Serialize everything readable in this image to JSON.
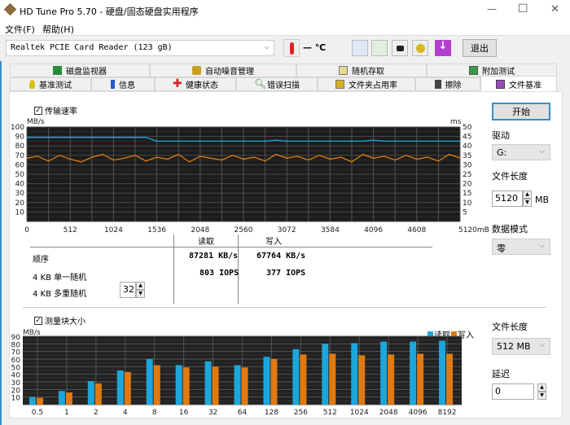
{
  "window": {
    "title": "HD Tune Pro 5.70 - 硬盘/固态硬盘实用程序",
    "minimize": "—",
    "maximize": "☐",
    "close": "✕"
  },
  "menu": [
    "文件(F)",
    "帮助(H)"
  ],
  "toolbar": {
    "drive": "Realtek PCIE Card Reader (123 gB)",
    "temp": "— ℃",
    "exit": "退出"
  },
  "tabs_row1": [
    "磁盘监视器",
    "自动噪音管理",
    "随机存取",
    "附加测试"
  ],
  "tabs_row2": [
    "基准测试",
    "信息",
    "健康状态",
    "错误扫描",
    "文件夹占用率",
    "擦除",
    "文件基准"
  ],
  "transfer": {
    "checkbox": "传输速率",
    "unit_left": "MB/s",
    "unit_right": "ms"
  },
  "results": {
    "col_read": "读取",
    "col_write": "写入",
    "rows": [
      {
        "label": "顺序",
        "read": "87281 KB/s",
        "write": "67764 KB/s"
      },
      {
        "label": "4 KB 单一随机",
        "read": "803 IOPS",
        "write": "377 IOPS"
      },
      {
        "label": "4 KB 多重随机",
        "read": "",
        "write": ""
      }
    ],
    "queue_depth": "32"
  },
  "right_top": {
    "start": "开始",
    "drive_label": "驱动",
    "drive": "G:",
    "file_len_label": "文件长度",
    "file_len": "5120",
    "file_len_unit": "MB",
    "pattern_label": "数据模式",
    "pattern": "零"
  },
  "block": {
    "checkbox": "测量块大小"
  },
  "right_bottom": {
    "file_len_label": "文件长度",
    "file_len": "512 MB",
    "delay_label": "延迟",
    "delay": "0"
  },
  "colors": {
    "read": "#1ca7dc",
    "write": "#e07a10",
    "accent": "#3a8fc7"
  },
  "chart_data": [
    {
      "type": "line",
      "title": "传输速率",
      "xlabel": "mB",
      "ylabel": "MB/s",
      "y2label": "ms",
      "xlim": [
        0,
        5120
      ],
      "ylim": [
        0,
        100
      ],
      "y2lim": [
        0,
        50
      ],
      "xticks": [
        "0",
        "512",
        "1024",
        "1536",
        "2048",
        "2560",
        "3072",
        "3584",
        "4096",
        "4608",
        "5120mB"
      ],
      "yticks": [
        "100",
        "90",
        "80",
        "70",
        "60",
        "50",
        "40",
        "30",
        "20",
        "10"
      ],
      "y2ticks": [
        "50",
        "45",
        "40",
        "35",
        "30",
        "25",
        "20",
        "15",
        "10",
        "5"
      ],
      "x": [
        0,
        128,
        256,
        384,
        512,
        640,
        768,
        896,
        1024,
        1152,
        1280,
        1408,
        1536,
        1664,
        1792,
        1920,
        2048,
        2176,
        2304,
        2432,
        2560,
        2688,
        2816,
        2944,
        3072,
        3200,
        3328,
        3456,
        3584,
        3712,
        3840,
        3968,
        4096,
        4224,
        4352,
        4480,
        4608,
        4736,
        4864,
        4992,
        5120
      ],
      "series": [
        {
          "name": "读取",
          "values": [
            89,
            89,
            89,
            89,
            89,
            89,
            89,
            89,
            89,
            89,
            89,
            89,
            85,
            85,
            85,
            85,
            85,
            85,
            85,
            85,
            85,
            85,
            85,
            86,
            85,
            85,
            85,
            85,
            85,
            85,
            85,
            85,
            86,
            85,
            85,
            85,
            85,
            85,
            85,
            85,
            85
          ]
        },
        {
          "name": "写入",
          "values": [
            67,
            69,
            64,
            70,
            66,
            63,
            68,
            71,
            65,
            67,
            70,
            64,
            68,
            66,
            71,
            63,
            69,
            67,
            65,
            70,
            66,
            68,
            64,
            71,
            67,
            69,
            65,
            70,
            66,
            68,
            63,
            71,
            67,
            69,
            65,
            70,
            66,
            68,
            64,
            71,
            67
          ]
        }
      ]
    },
    {
      "type": "bar",
      "title": "测量块大小",
      "ylabel": "MB/s",
      "ylim": [
        0,
        90
      ],
      "yticks": [
        "90",
        "80",
        "70",
        "60",
        "50",
        "40",
        "30",
        "20",
        "10"
      ],
      "categories": [
        "0.5",
        "1",
        "2",
        "4",
        "8",
        "16",
        "32",
        "64",
        "128",
        "256",
        "512",
        "1024",
        "2048",
        "4096",
        "8192"
      ],
      "series": [
        {
          "name": "读取",
          "values": [
            10,
            18,
            31,
            45,
            60,
            52,
            57,
            52,
            63,
            73,
            80,
            81,
            83,
            83,
            84
          ]
        },
        {
          "name": "写入",
          "values": [
            9,
            16,
            28,
            43,
            52,
            49,
            50,
            49,
            60,
            66,
            67,
            65,
            66,
            67,
            67
          ]
        }
      ]
    }
  ]
}
